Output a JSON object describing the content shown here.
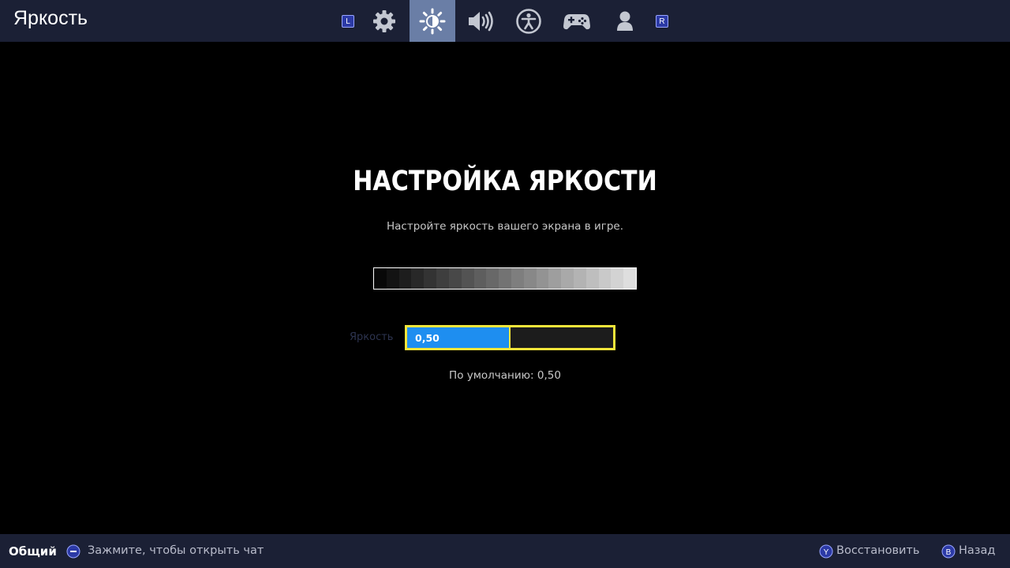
{
  "header": {
    "title": "Яркость",
    "left_button": "L",
    "right_button": "R",
    "tabs": [
      {
        "icon": "gear-icon",
        "active": false
      },
      {
        "icon": "brightness-icon",
        "active": true
      },
      {
        "icon": "speaker-icon",
        "active": false
      },
      {
        "icon": "accessibility-icon",
        "active": false
      },
      {
        "icon": "gamepad-icon",
        "active": false
      },
      {
        "icon": "account-icon",
        "active": false
      }
    ]
  },
  "main": {
    "heading": "НАСТРОЙКА ЯРКОСТИ",
    "subtitle": "Настройте яркость вашего экрана в игре.",
    "gradient_steps": 21,
    "slider": {
      "label": "Яркость",
      "value_text": "0,50",
      "fraction": 0.5,
      "default_text": "По умолчанию: 0,50"
    }
  },
  "footer": {
    "channel": "Общий",
    "chat_hint": "Зажмите, чтобы открыть чат",
    "reset_button_glyph": "Y",
    "reset_label": "Восстановить",
    "back_button_glyph": "B",
    "back_label": "Назад"
  },
  "colors": {
    "bar_background": "#1b2035",
    "active_tab": "#6a7ea6",
    "slider_fill": "#1e8ef0",
    "focus_border": "#f3e53a"
  }
}
